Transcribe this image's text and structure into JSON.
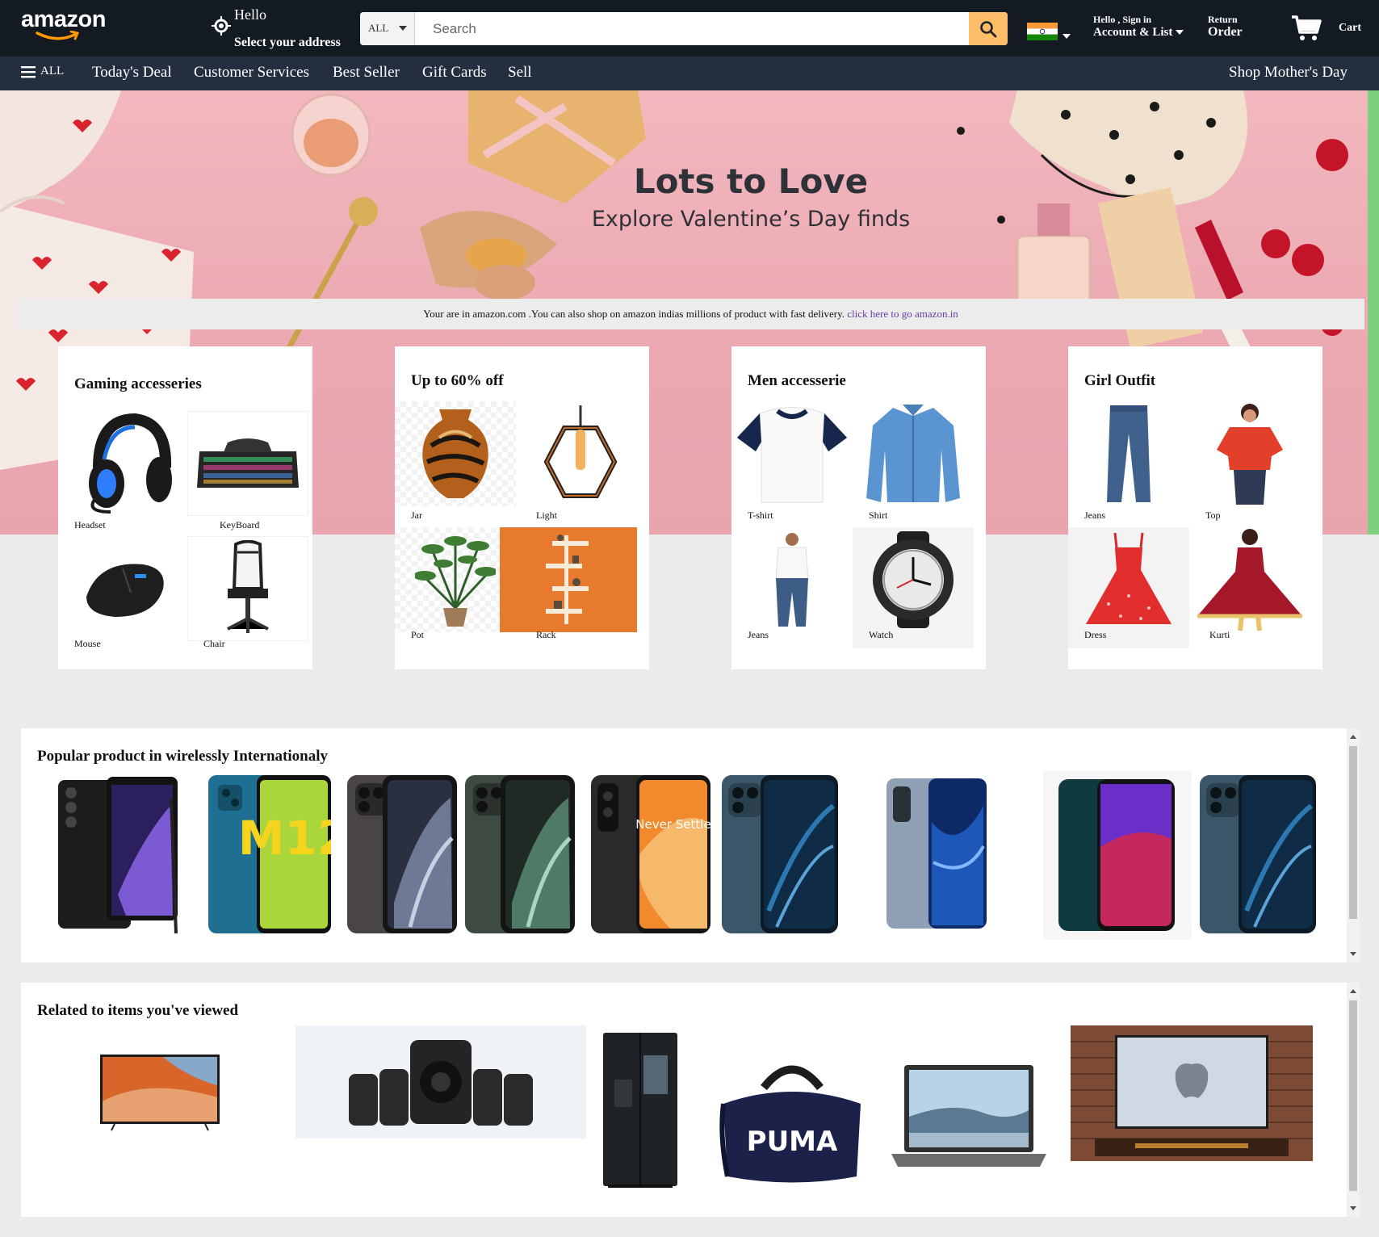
{
  "header": {
    "logo": "amazon",
    "address_hello": "Hello",
    "address_select": "Select your address",
    "search_category": "ALL",
    "search_placeholder": "Search",
    "account_hello": "Hello , Sign in",
    "account_list": "Account & List",
    "returns_top": "Return",
    "returns_bottom": "Order",
    "cart_label": "Cart"
  },
  "nav": {
    "all_label": "ALL",
    "items": [
      "Today's Deal",
      "Customer Services",
      "Best Seller",
      "Gift Cards",
      "Sell"
    ],
    "right_item": "Shop Mother's Day"
  },
  "hero": {
    "title": "Lots to Love",
    "subtitle": "Explore Valentine’s Day finds"
  },
  "notice": {
    "text": "Your are in amazon.com .You can also shop on amazon indias millions of product with fast delivery. ",
    "link": "click here to go amazon.in"
  },
  "cards": [
    {
      "title": "Gaming accesseries",
      "items": [
        "Headset",
        "KeyBoard",
        "Mouse",
        "Chair"
      ]
    },
    {
      "title": "Up to 60% off",
      "items": [
        "Jar",
        "Light",
        "Pot",
        "Rack"
      ]
    },
    {
      "title": "Men accesserie",
      "items": [
        "T-shirt",
        "Shirt",
        "Jeans",
        "Watch"
      ]
    },
    {
      "title": "Girl Outfit",
      "items": [
        "Jeans",
        "Top",
        "Dress",
        "Kurti"
      ]
    }
  ],
  "carousels": {
    "popular_title": "Popular product in wirelessly Internationaly",
    "popular_phone_text": {
      "m12": "M12",
      "never_settle": "Never Settle"
    },
    "related_title": "Related to items you've viewed",
    "related_bag_brand": "PUMA"
  },
  "colors": {
    "header_bg": "#131a22",
    "nav_bg": "#232f3e",
    "search_button": "#febd69",
    "hero_pink": "#eba8b1",
    "link_purple": "#6a3aa8"
  }
}
